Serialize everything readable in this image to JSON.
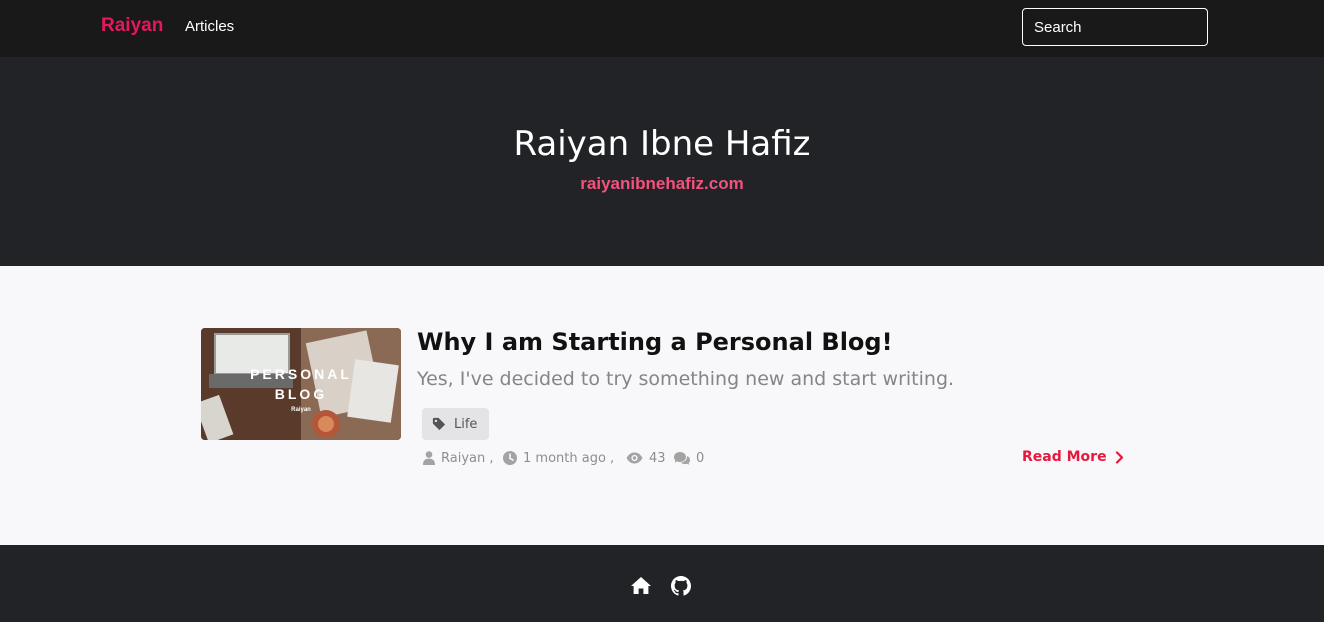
{
  "navbar": {
    "brand": "Raiyan",
    "links": [
      {
        "label": "Articles"
      }
    ],
    "search": {
      "placeholder": "Search",
      "value": ""
    }
  },
  "hero": {
    "title": "Raiyan Ibne Hafiz",
    "subtitle": "raiyanibnehafiz.com"
  },
  "posts": [
    {
      "thumbnail": {
        "lines": [
          "PERSONAL",
          "BLOG"
        ],
        "caption": "Raiyan"
      },
      "title": "Why I am Starting a Personal Blog!",
      "description": "Yes, I've decided to try something new and start writing.",
      "tag": "Life",
      "author": "Raiyan ,",
      "time": "1 month ago ,",
      "views": "43",
      "comments": "0",
      "read_more": "Read More"
    }
  ],
  "footer": {
    "icons": [
      "home-icon",
      "github-icon"
    ]
  },
  "colors": {
    "accent": "#e8175d",
    "subtitle": "#f4517d",
    "nav_bg": "#191919",
    "hero_bg": "#222327",
    "page_bg": "#f8f8fa"
  }
}
